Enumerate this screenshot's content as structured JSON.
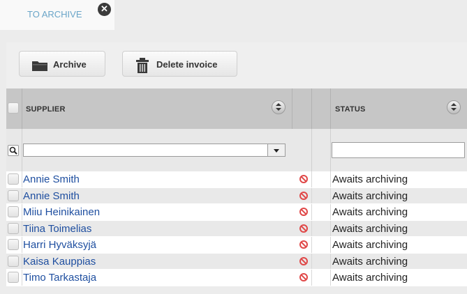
{
  "tab": {
    "label": "TO ARCHIVE",
    "close": "✕"
  },
  "toolbar": {
    "archive_label": "Archive",
    "delete_label": "Delete invoice"
  },
  "grid": {
    "columns": {
      "supplier": "SUPPLIER",
      "status": "STATUS"
    },
    "filter": {
      "supplier_value": "",
      "status_value": ""
    },
    "rows": [
      {
        "supplier": "Annie Smith",
        "status": "Awaits archiving"
      },
      {
        "supplier": "Annie Smith",
        "status": "Awaits archiving"
      },
      {
        "supplier": "Miiu Heinikainen",
        "status": "Awaits archiving"
      },
      {
        "supplier": "Tiina Toimelias",
        "status": "Awaits archiving"
      },
      {
        "supplier": "Harri Hyväksyjä",
        "status": "Awaits archiving"
      },
      {
        "supplier": "Kaisa Kauppias",
        "status": "Awaits archiving"
      },
      {
        "supplier": "Timo Tarkastaja",
        "status": "Awaits archiving"
      }
    ]
  },
  "colors": {
    "link": "#1f4fa0",
    "tab_label": "#6aa5c8",
    "blocked": "#e04848"
  },
  "icons": [
    "close-icon",
    "folder-icon",
    "trash-icon",
    "sort-icon",
    "search-icon",
    "dropdown-arrow-icon",
    "blocked-icon"
  ]
}
